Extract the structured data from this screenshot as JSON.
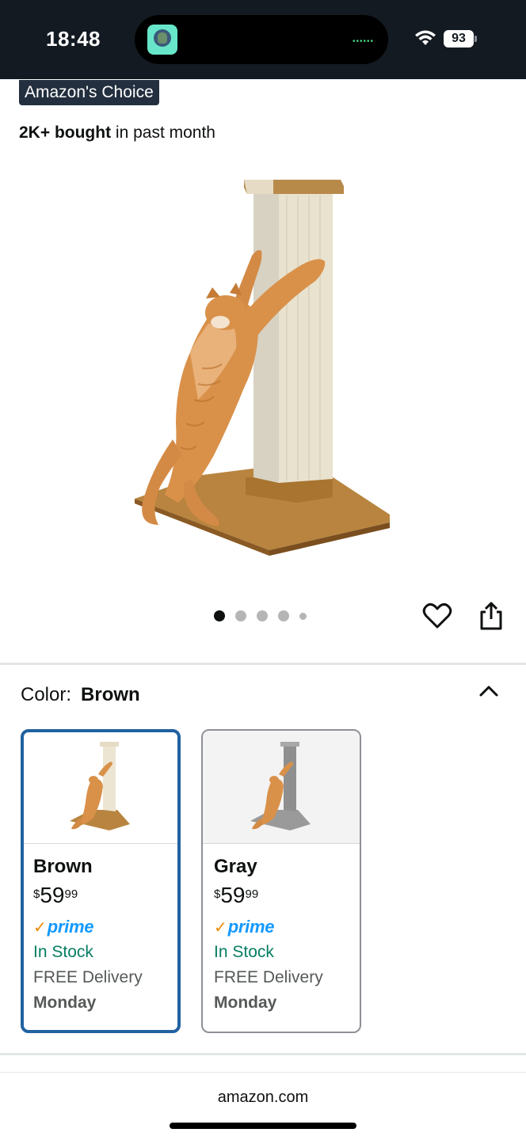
{
  "status_bar": {
    "time": "18:48",
    "battery": "93",
    "activity_icon": "app-activity-icon"
  },
  "product": {
    "badge": "Amazon's Choice",
    "bought_count": "2K+ bought",
    "bought_suffix": " in past month",
    "image_count": 5,
    "image_active_index": 0
  },
  "actions": {
    "wishlist_icon": "heart-icon",
    "share_icon": "share-icon"
  },
  "variant_selector": {
    "label": "Color:",
    "selected_value": "Brown",
    "toggle_icon": "chevron-up-icon",
    "options": [
      {
        "name": "Brown",
        "price_symbol": "$",
        "price_whole": "59",
        "price_fraction": "99",
        "prime_check": "✓",
        "prime_word": "prime",
        "stock": "In Stock",
        "delivery": "FREE Delivery",
        "delivery_day": "Monday",
        "selected": true
      },
      {
        "name": "Gray",
        "price_symbol": "$",
        "price_whole": "59",
        "price_fraction": "99",
        "prime_check": "✓",
        "prime_word": "prime",
        "stock": "In Stock",
        "delivery": "FREE Delivery",
        "delivery_day": "Monday",
        "selected": false
      }
    ]
  },
  "browser": {
    "url": "amazon.com"
  },
  "colors": {
    "status_bar_bg": "#131a22",
    "badge_bg": "#232f3e",
    "selected_border": "#2162a1",
    "in_stock": "#067d62",
    "prime_blue": "#1399ff",
    "prime_check": "#f08804"
  }
}
